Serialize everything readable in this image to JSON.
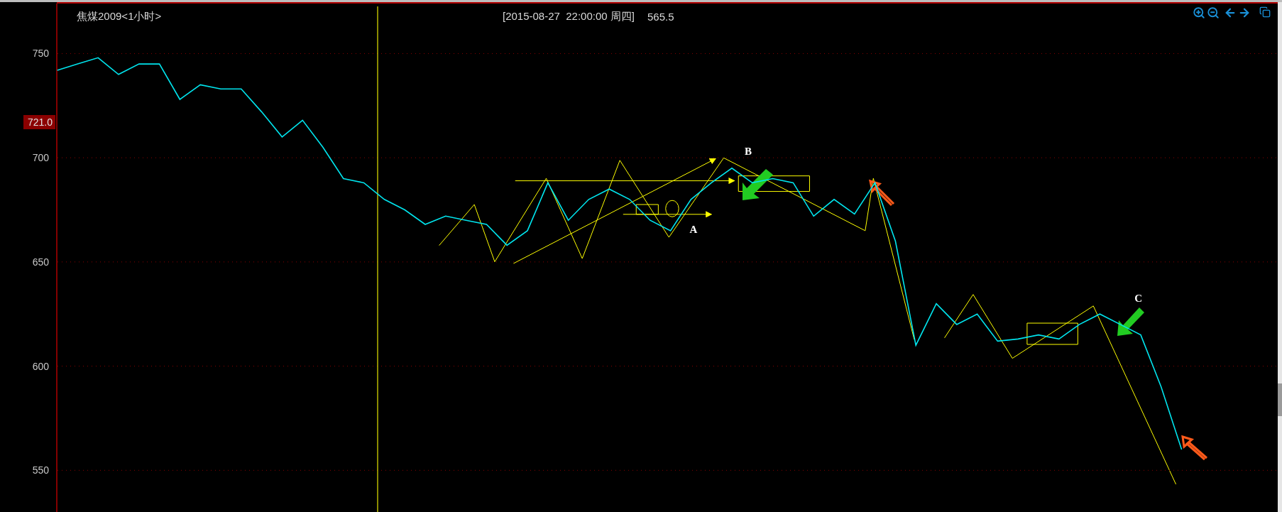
{
  "header": {
    "title": "焦煤2009<1小时>",
    "datetime": "[2015-08-27  22:00:00 周四]",
    "price": "565.5"
  },
  "cursor_price": "721.0",
  "chart": {
    "chart_data": {
      "type": "line",
      "ylim": [
        530,
        774
      ],
      "yticks": [
        550,
        600,
        650,
        700,
        750
      ],
      "series": [
        {
          "color": "#00e5ee",
          "values": [
            742,
            745,
            748,
            740,
            745,
            745,
            728,
            735,
            733,
            733,
            722,
            710,
            718,
            705,
            690,
            688,
            680,
            675,
            668,
            672,
            670,
            668,
            658,
            665,
            688,
            670,
            680,
            685,
            680,
            670,
            665,
            680,
            688,
            695,
            688,
            690,
            688,
            672,
            680,
            673,
            688,
            660,
            610,
            630,
            620,
            625,
            612,
            613,
            615,
            613,
            620,
            625,
            620,
            615,
            590,
            560
          ]
        }
      ],
      "grid": true,
      "annotations": [
        "A",
        "B",
        "C"
      ]
    }
  }
}
